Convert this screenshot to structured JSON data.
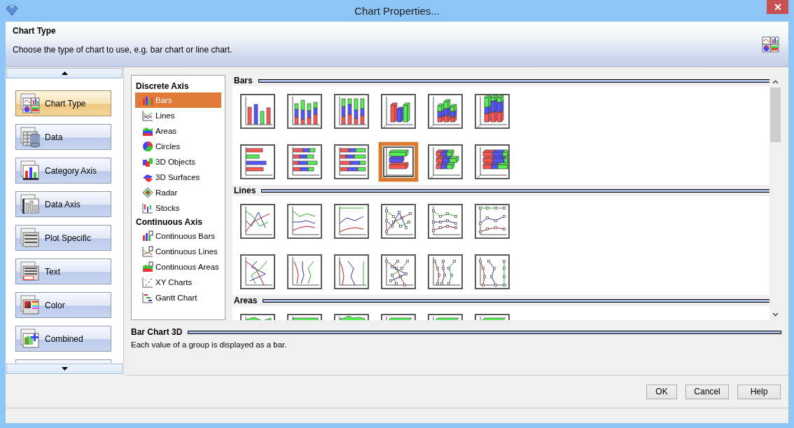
{
  "window": {
    "title": "Chart Properties..."
  },
  "header": {
    "title": "Chart Type",
    "description": "Choose the type of chart to use, e.g. bar chart or line chart."
  },
  "nav": {
    "items": [
      {
        "label": "Chart Type",
        "kind": "chart-type",
        "selected": true
      },
      {
        "label": "Data",
        "kind": "data",
        "selected": false
      },
      {
        "label": "Category Axis",
        "kind": "category-axis",
        "selected": false
      },
      {
        "label": "Data Axis",
        "kind": "data-axis",
        "selected": false
      },
      {
        "label": "Plot Specific",
        "kind": "plot-specific",
        "selected": false
      },
      {
        "label": "Text",
        "kind": "text",
        "selected": false
      },
      {
        "label": "Color",
        "kind": "color",
        "selected": false
      },
      {
        "label": "Combined",
        "kind": "combined",
        "selected": false
      },
      {
        "kind": "hidden",
        "selected": false
      }
    ]
  },
  "type_list": {
    "groups": [
      {
        "heading": "Discrete Axis",
        "items": [
          {
            "label": "Bars",
            "kind": "bars",
            "selected": true
          },
          {
            "label": "Lines",
            "kind": "lines",
            "selected": false
          },
          {
            "label": "Areas",
            "kind": "areas",
            "selected": false
          },
          {
            "label": "Circles",
            "kind": "circles",
            "selected": false
          },
          {
            "label": "3D Objects",
            "kind": "objects3d",
            "selected": false
          },
          {
            "label": "3D Surfaces",
            "kind": "surfaces3d",
            "selected": false
          },
          {
            "label": "Radar",
            "kind": "radar",
            "selected": false
          },
          {
            "label": "Stocks",
            "kind": "stocks",
            "selected": false
          }
        ]
      },
      {
        "heading": "Continuous Axis",
        "items": [
          {
            "label": "Continuous Bars",
            "kind": "cbars",
            "selected": false
          },
          {
            "label": "Continuous Lines",
            "kind": "clines",
            "selected": false
          },
          {
            "label": "Continuous Areas",
            "kind": "careas",
            "selected": false
          },
          {
            "label": "XY Charts",
            "kind": "xy",
            "selected": false
          },
          {
            "label": "Gantt Chart",
            "kind": "gantt",
            "selected": false
          }
        ]
      }
    ]
  },
  "gallery": {
    "sections": [
      {
        "heading": "Bars",
        "items": [
          {
            "kind": "vbar",
            "selected": false
          },
          {
            "kind": "vbar-stacked",
            "selected": false
          },
          {
            "kind": "vbar-100",
            "selected": false
          },
          {
            "kind": "vbar-3d",
            "selected": false
          },
          {
            "kind": "vbar-3d-stacked",
            "selected": false
          },
          {
            "kind": "vbar-3d-100",
            "selected": false
          },
          {
            "kind": "hbar",
            "selected": false
          },
          {
            "kind": "hbar-stacked",
            "selected": false
          },
          {
            "kind": "hbar-100",
            "selected": false
          },
          {
            "kind": "hbar-3d",
            "selected": true
          },
          {
            "kind": "hbar-3d-stacked",
            "selected": false
          },
          {
            "kind": "hbar-3d-100",
            "selected": false
          }
        ]
      },
      {
        "heading": "Lines",
        "items": [
          {
            "kind": "line",
            "selected": false
          },
          {
            "kind": "line-stacked",
            "selected": false
          },
          {
            "kind": "line-100",
            "selected": false
          },
          {
            "kind": "line-marked",
            "selected": false
          },
          {
            "kind": "line-marked-stacked",
            "selected": false
          },
          {
            "kind": "line-marked-100",
            "selected": false
          },
          {
            "kind": "vline",
            "selected": false
          },
          {
            "kind": "vline-stacked",
            "selected": false
          },
          {
            "kind": "vline-100",
            "selected": false
          },
          {
            "kind": "vline-marked",
            "selected": false
          },
          {
            "kind": "vline-marked-stacked",
            "selected": false
          },
          {
            "kind": "vline-marked-100",
            "selected": false
          }
        ]
      },
      {
        "heading": "Areas",
        "items": [
          {
            "kind": "area",
            "selected": false
          },
          {
            "kind": "area-stacked",
            "selected": false
          },
          {
            "kind": "area-100",
            "selected": false
          },
          {
            "kind": "area-3d",
            "selected": false
          },
          {
            "kind": "area-3d-stacked",
            "selected": false
          },
          {
            "kind": "area-3d-100",
            "selected": false
          }
        ]
      }
    ]
  },
  "description": {
    "title": "Bar Chart 3D",
    "text": "Each value of a group is displayed as a bar."
  },
  "buttons": [
    "OK",
    "Cancel",
    "Help"
  ]
}
